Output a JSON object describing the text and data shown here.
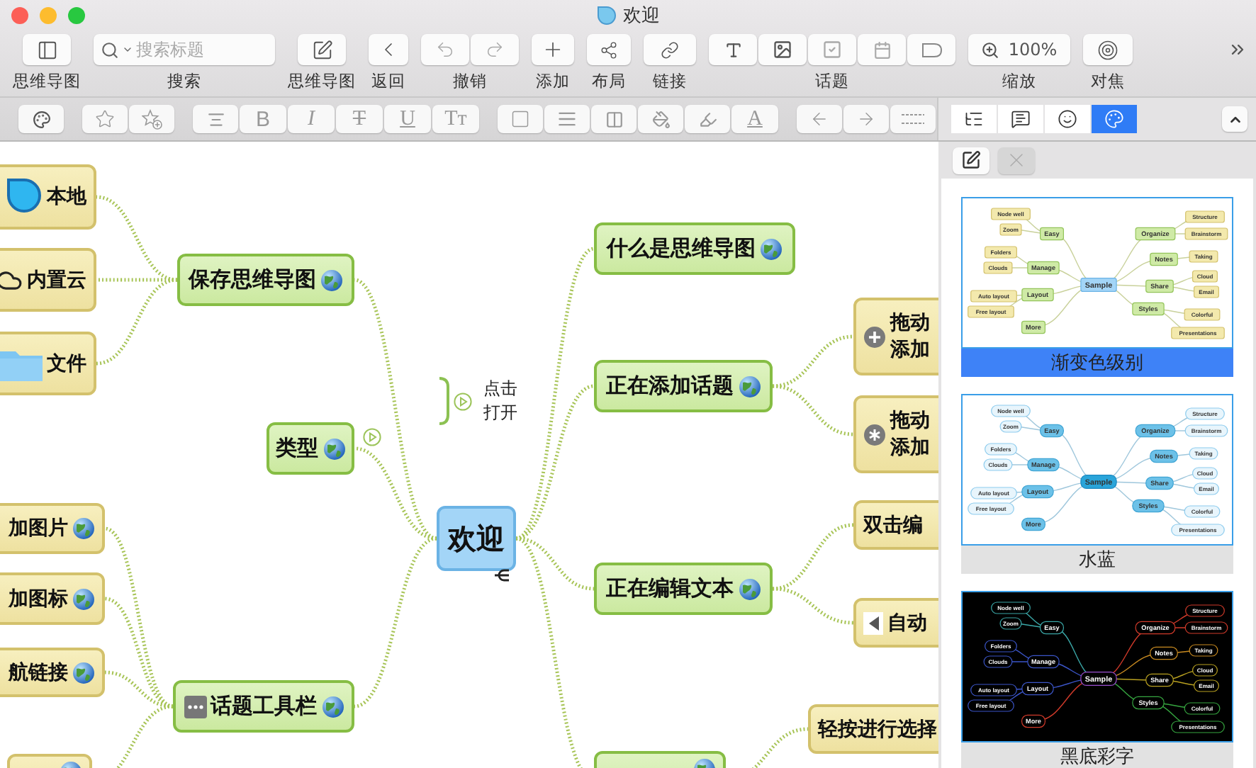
{
  "window": {
    "title": "欢迎"
  },
  "toolbar": [
    {
      "kind": "sidebar",
      "label": "思维导图"
    },
    {
      "kind": "search",
      "label": "搜索",
      "placeholder": "搜索标题"
    },
    {
      "kind": "edit",
      "label": "思维导图"
    },
    {
      "kind": "back",
      "label": "返回"
    },
    {
      "kind": "undo",
      "label": "撤销"
    },
    {
      "kind": "add",
      "label": "添加"
    },
    {
      "kind": "layout",
      "label": "布局"
    },
    {
      "kind": "link",
      "label": "链接"
    },
    {
      "kind": "topic",
      "label": "话题"
    },
    {
      "kind": "zoom",
      "label": "缩放",
      "value": "100%"
    },
    {
      "kind": "focus",
      "label": "对焦"
    }
  ],
  "format_bar": {
    "text_styles": [
      {
        "kind": "bold",
        "label": "B"
      },
      {
        "kind": "italic",
        "label": "I"
      },
      {
        "kind": "strike",
        "label": "T"
      },
      {
        "kind": "underline",
        "label": "U"
      },
      {
        "kind": "size",
        "label": "Tт"
      }
    ],
    "color_label": "A"
  },
  "mind_map": {
    "center": {
      "text": "欢迎"
    },
    "left_topics": [
      {
        "text": "保存思维导图",
        "link": true,
        "children": [
          {
            "kind": "drop",
            "text": "本地"
          },
          {
            "kind": "cloud",
            "text": "内置云"
          },
          {
            "kind": "folder",
            "text": "文件"
          }
        ]
      },
      {
        "text": "类型",
        "link": true
      },
      {
        "kind": "dots",
        "text": "话题工具栏",
        "link": true,
        "children": [
          {
            "text": "加图片",
            "link": true
          },
          {
            "text": "加图标",
            "link": true
          },
          {
            "text": "航链接",
            "link": true
          },
          {
            "link": true
          }
        ]
      }
    ],
    "right_topics": [
      {
        "text": "什么是思维导图",
        "link": true
      },
      {
        "text": "正在添加话题",
        "link": true,
        "children": [
          {
            "kind": "plus",
            "lines": [
              "拖动",
              "添加"
            ]
          },
          {
            "kind": "asterisk",
            "lines": [
              "拖动",
              "添加"
            ]
          }
        ]
      },
      {
        "text": "正在编辑文本",
        "link": true,
        "children": [
          {
            "text": "双击编"
          },
          {
            "kind": "triangle",
            "text": "自动"
          }
        ]
      },
      {
        "link": true,
        "children": [
          {
            "text": "轻按进行选择"
          }
        ]
      }
    ],
    "callout": {
      "lines": [
        "点击",
        "打开"
      ]
    }
  },
  "panel": {
    "tabs": [
      {
        "kind": "outline",
        "selected": false
      },
      {
        "kind": "notes",
        "selected": false
      },
      {
        "kind": "emoji",
        "selected": false
      },
      {
        "kind": "style",
        "selected": true
      }
    ],
    "themes": [
      {
        "name": "渐变色级别",
        "kind": "gradient",
        "selected": true,
        "preview": {
          "center": "Sample",
          "topics": [
            {
              "text": "Easy",
              "children": [
                "Node well",
                "Zoom"
              ]
            },
            {
              "text": "Manage",
              "children": [
                "Folders",
                "Clouds"
              ]
            },
            {
              "text": "Layout",
              "children": [
                "Auto layout",
                "Free layout"
              ]
            },
            {
              "text": "More"
            },
            {
              "text": "Organize",
              "children": [
                "Structure",
                "Brainstorm"
              ]
            },
            {
              "text": "Notes",
              "children": [
                "Taking"
              ]
            },
            {
              "text": "Share",
              "children": [
                "Cloud",
                "Email"
              ]
            },
            {
              "text": "Styles",
              "children": [
                "Colorful",
                "Presentations"
              ]
            }
          ]
        }
      },
      {
        "name": "水蓝",
        "kind": "aqua",
        "selected": false,
        "preview": {
          "center": "Sample",
          "topics": [
            {
              "text": "Easy",
              "children": [
                "Node well",
                "Zoom"
              ]
            },
            {
              "text": "Manage",
              "children": [
                "Folders",
                "Clouds"
              ]
            },
            {
              "text": "Layout",
              "children": [
                "Auto layout",
                "Free layout"
              ]
            },
            {
              "text": "More"
            },
            {
              "text": "Organize",
              "children": [
                "Structure",
                "Brainstorm"
              ]
            },
            {
              "text": "Notes",
              "children": [
                "Taking"
              ]
            },
            {
              "text": "Share",
              "children": [
                "Cloud",
                "Email"
              ]
            },
            {
              "text": "Styles",
              "children": [
                "Colorful",
                "Presentations"
              ]
            }
          ]
        }
      },
      {
        "name": "黑底彩字",
        "kind": "dark",
        "selected": false,
        "preview": {
          "center": "Sample",
          "topics": [
            {
              "text": "Easy",
              "children": [
                "Node well",
                "Zoom"
              ]
            },
            {
              "text": "Manage",
              "children": [
                "Folders",
                "Clouds"
              ]
            },
            {
              "text": "Layout",
              "children": [
                "Auto layout",
                "Free layout"
              ]
            },
            {
              "text": "More"
            },
            {
              "text": "Organize",
              "children": [
                "Structure",
                "Brainstorm"
              ]
            },
            {
              "text": "Notes",
              "children": [
                "Taking"
              ]
            },
            {
              "text": "Share",
              "children": [
                "Cloud",
                "Email"
              ]
            },
            {
              "text": "Styles",
              "children": [
                "Colorful",
                "Presentations"
              ]
            }
          ]
        }
      }
    ]
  }
}
